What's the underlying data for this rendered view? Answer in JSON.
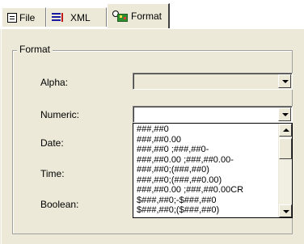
{
  "tabs": [
    {
      "label": "File",
      "icon": "file-icon",
      "active": false
    },
    {
      "label": "XML",
      "icon": "xml-icon",
      "active": false
    },
    {
      "label": "Format",
      "icon": "format-icon",
      "active": true
    }
  ],
  "group": {
    "legend": "Format",
    "rows": [
      {
        "label": "Alpha:"
      },
      {
        "label": "Numeric:"
      },
      {
        "label": "Date:"
      },
      {
        "label": "Time:"
      },
      {
        "label": "Boolean:"
      }
    ]
  },
  "numeric_dropdown": {
    "selected": "",
    "options": [
      "###,##0",
      "###,##0.00",
      "###,##0 ;###,##0-",
      "###,##0.00 ;###,##0.00-",
      "###,##0;(###,##0)",
      "###,##0;(###,##0.00)",
      "###,##0.00 ;###,##0.00CR",
      "$###,##0;-$###,##0",
      "$###,##0;($###,##0)"
    ]
  }
}
